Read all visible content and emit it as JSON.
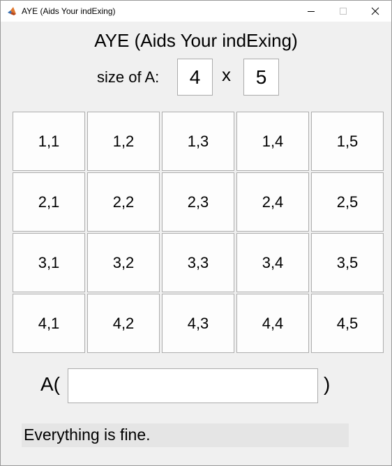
{
  "window": {
    "title": "AYE (Aids Your indExing)",
    "icon": "matlab-icon"
  },
  "header": {
    "title": "AYE (Aids Your indExing)",
    "size_label": "size of A:",
    "rows": "4",
    "times": "x",
    "cols": "5"
  },
  "grid": {
    "cells": [
      [
        "1,1",
        "1,2",
        "1,3",
        "1,4",
        "1,5"
      ],
      [
        "2,1",
        "2,2",
        "2,3",
        "2,4",
        "2,5"
      ],
      [
        "3,1",
        "3,2",
        "3,3",
        "3,4",
        "3,5"
      ],
      [
        "4,1",
        "4,2",
        "4,3",
        "4,4",
        "4,5"
      ]
    ]
  },
  "index": {
    "prefix": "A(",
    "value": "",
    "suffix": ")"
  },
  "status": {
    "text": "Everything is fine."
  }
}
